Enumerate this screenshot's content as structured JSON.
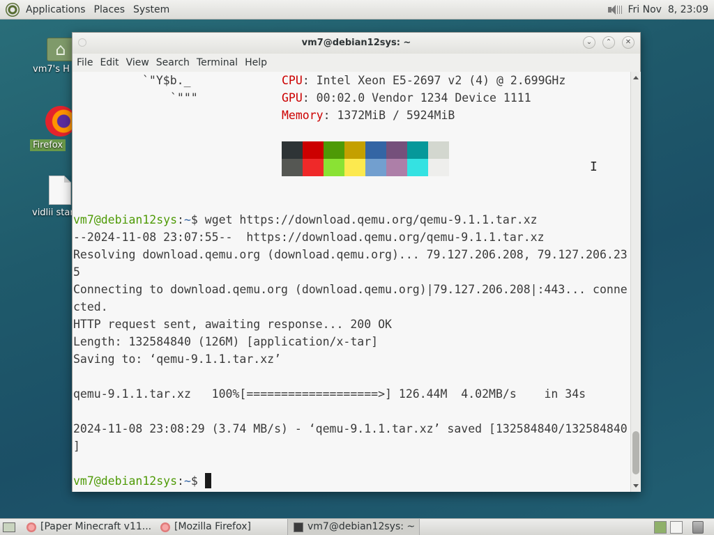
{
  "top_panel": {
    "menus": [
      "Applications",
      "Places",
      "System"
    ],
    "clock": "Fri Nov  8, 23:09"
  },
  "desktop": {
    "icons": [
      {
        "label": "vm7's H",
        "icon": "home-folder-icon"
      },
      {
        "label": "Firefox",
        "icon": "firefox-icon"
      },
      {
        "label": "vidlii star",
        "icon": "text-file-icon"
      }
    ]
  },
  "window": {
    "title": "vm7@debian12sys: ~",
    "menu": [
      "File",
      "Edit",
      "View",
      "Search",
      "Terminal",
      "Help"
    ],
    "buttons": {
      "minimize": "⌄",
      "maximize": "⌃",
      "close": "✕"
    }
  },
  "terminal": {
    "ascii_1": "`\"Y$b._",
    "ascii_2": "`\"\"\"",
    "cpu_key": "CPU",
    "cpu_val": ": Intel Xeon E5-2697 v2 (4) @ 2.699GHz",
    "gpu_key": "GPU",
    "gpu_val": ": 00:02.0 Vendor 1234 Device 1111",
    "mem_key": "Memory",
    "mem_val": ": 1372MiB / 5924MiB",
    "palette_top": [
      "#2e3436",
      "#cc0000",
      "#4e9a06",
      "#c4a000",
      "#3465a4",
      "#75507b",
      "#06989a",
      "#d3d7cf"
    ],
    "palette_bottom": [
      "#555753",
      "#ef2929",
      "#8ae234",
      "#fce94f",
      "#729fcf",
      "#ad7fa8",
      "#34e2e2",
      "#eeeeec"
    ],
    "prompt_user": "vm7@debian12sys",
    "prompt_sep": ":",
    "prompt_dir": "~",
    "prompt_sym": "$ ",
    "command": "wget https://download.qemu.org/qemu-9.1.1.tar.xz",
    "output": [
      "--2024-11-08 23:07:55--  https://download.qemu.org/qemu-9.1.1.tar.xz",
      "Resolving download.qemu.org (download.qemu.org)... 79.127.206.208, 79.127.206.23",
      "5",
      "Connecting to download.qemu.org (download.qemu.org)|79.127.206.208|:443... conne",
      "cted.",
      "HTTP request sent, awaiting response... 200 OK",
      "Length: 132584840 (126M) [application/x-tar]",
      "Saving to: ‘qemu-9.1.1.tar.xz’",
      "",
      "qemu-9.1.1.tar.xz   100%[===================>] 126.44M  4.02MB/s    in 34s",
      "",
      "2024-11-08 23:08:29 (3.74 MB/s) - ‘qemu-9.1.1.tar.xz’ saved [132584840/132584840",
      "]"
    ]
  },
  "taskbar": {
    "tasks": [
      {
        "label": "[Paper Minecraft v11...."
      },
      {
        "label": "[Mozilla Firefox]"
      },
      {
        "label": "vm7@debian12sys: ~"
      }
    ]
  }
}
